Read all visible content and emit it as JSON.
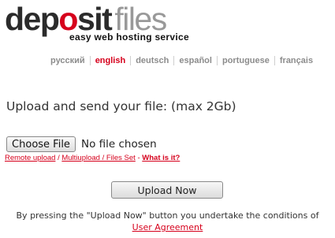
{
  "logo": {
    "part_dep": "dep",
    "part_o": "o",
    "part_sit": "sit",
    "part_files": "files"
  },
  "tagline": "easy web hosting service",
  "languages": [
    {
      "label": "русский",
      "active": false
    },
    {
      "label": "english",
      "active": true
    },
    {
      "label": "deutsch",
      "active": false
    },
    {
      "label": "español",
      "active": false
    },
    {
      "label": "portuguese",
      "active": false
    },
    {
      "label": "français",
      "active": false
    }
  ],
  "upload": {
    "heading": "Upload and send your file: (max 2Gb)",
    "choose_file_label": "Choose File",
    "no_file_text": "No file chosen",
    "remote_upload": "Remote upload",
    "separator": " / ",
    "multiupload": "Multiupload / Files Set",
    "dash": " - ",
    "what_is_it": "What is it?",
    "upload_now_label": "Upload Now"
  },
  "agreement": {
    "text": "By pressing the \"Upload Now\" button you undertake the conditions of",
    "link": "User Agreement"
  },
  "colors": {
    "accent": "#d6001c",
    "lang_inactive": "#8c8c8c"
  }
}
